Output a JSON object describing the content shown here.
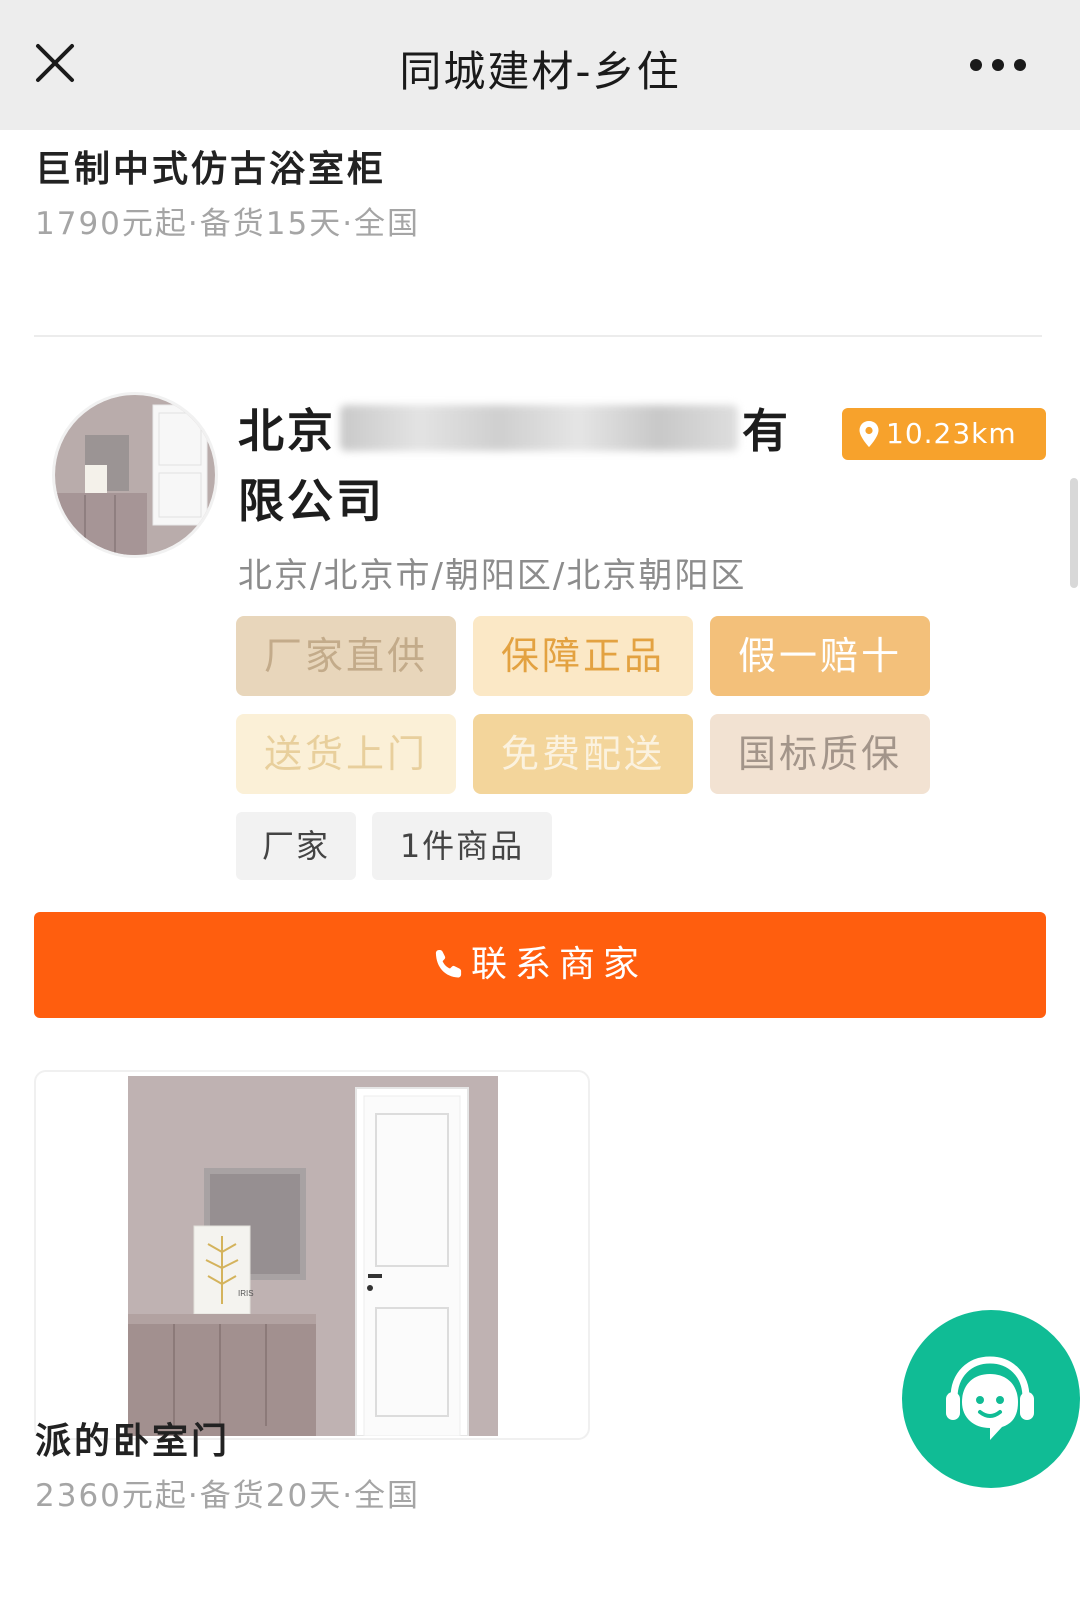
{
  "header": {
    "title": "同城建材-乡住",
    "close_icon": "close-icon",
    "more_icon": "more-dots-icon"
  },
  "previous_product": {
    "title": "巨制中式仿古浴室柜",
    "meta": "1790元起·备货15天·全国"
  },
  "shop": {
    "name_prefix": "北京",
    "name_suffix": "有限公司",
    "distance": "10.23km",
    "distance_icon": "location-pin-icon",
    "region": "北京/北京市/朝阳区/北京朝阳区",
    "tags": [
      "厂家直供",
      "保障正品",
      "假一赔十",
      "送货上门",
      "免费配送",
      "国标质保"
    ],
    "chips": [
      "厂家",
      "1件商品"
    ],
    "contact_label": "联系商家",
    "contact_icon": "phone-icon"
  },
  "product": {
    "title": "派的卧室门",
    "meta": "2360元起·备货20天·全国",
    "image_text": "IRIS"
  },
  "colors": {
    "accent_orange": "#ff5e0e",
    "distance_badge": "#f7a22c",
    "chat_fab": "#10bc95",
    "header_bg": "#ededed"
  },
  "chat_fab": {
    "icon": "customer-service-icon"
  }
}
